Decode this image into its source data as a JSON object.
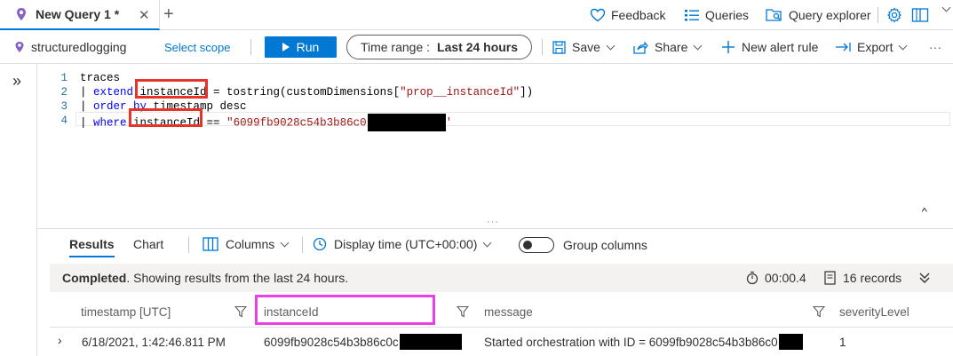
{
  "tabbar": {
    "tab_title": "New Query 1",
    "tab_modified": "*",
    "close_glyph": "✕",
    "add_glyph": "+",
    "feedback": "Feedback",
    "queries": "Queries",
    "query_explorer": "Query explorer"
  },
  "toolbar": {
    "scope_name": "structuredlogging",
    "select_scope": "Select scope",
    "run": "Run",
    "time_range_label": "Time range :",
    "time_range_value": "Last 24 hours",
    "save": "Save",
    "share": "Share",
    "new_alert_rule": "New alert rule",
    "export": "Export",
    "more": "···"
  },
  "editor": {
    "lines": [
      {
        "n": "1",
        "parts": [
          {
            "t": "traces",
            "c": "plain"
          }
        ]
      },
      {
        "n": "2",
        "parts": [
          {
            "t": "| ",
            "c": "plain"
          },
          {
            "t": "extend",
            "c": "kw"
          },
          {
            "t": " instanceId = tostring(customDimensions[",
            "c": "plain"
          },
          {
            "t": "\"prop__instanceId\"",
            "c": "str"
          },
          {
            "t": "])",
            "c": "plain"
          }
        ]
      },
      {
        "n": "3",
        "parts": [
          {
            "t": "| ",
            "c": "plain"
          },
          {
            "t": "order by",
            "c": "kw"
          },
          {
            "t": " timestamp desc",
            "c": "plain"
          }
        ]
      },
      {
        "n": "4",
        "parts": [
          {
            "t": "| ",
            "c": "plain"
          },
          {
            "t": "where",
            "c": "kw"
          },
          {
            "t": " instanceId == ",
            "c": "plain"
          },
          {
            "t": "\"6099fb9028c54b3b86c0",
            "c": "str"
          }
        ]
      }
    ],
    "line4_trailing_quote": "'",
    "collapse_glyph": "⌃",
    "splitter_glyph": "···"
  },
  "results": {
    "tab_results": "Results",
    "tab_chart": "Chart",
    "columns": "Columns",
    "display_time": "Display time (UTC+00:00)",
    "group_columns": "Group columns",
    "status_bold": "Completed",
    "status_rest": ". Showing results from the last 24 hours.",
    "duration": "00:00.4",
    "records": "16 records"
  },
  "grid": {
    "headers": [
      "timestamp [UTC]",
      "instanceId",
      "message",
      "severityLevel"
    ],
    "row": {
      "timestamp": "6/18/2021, 1:42:46.811 PM",
      "instanceId": "6099fb9028c54b3b86c0c",
      "message": "Started orchestration with ID = 6099fb9028c54b3b86c0",
      "severityLevel": "1"
    }
  },
  "colors": {
    "accent": "#0078d4",
    "highlight_red": "#e8332a",
    "highlight_magenta": "#ee3fe6",
    "keyword": "#0000ff",
    "string": "#a31515"
  }
}
